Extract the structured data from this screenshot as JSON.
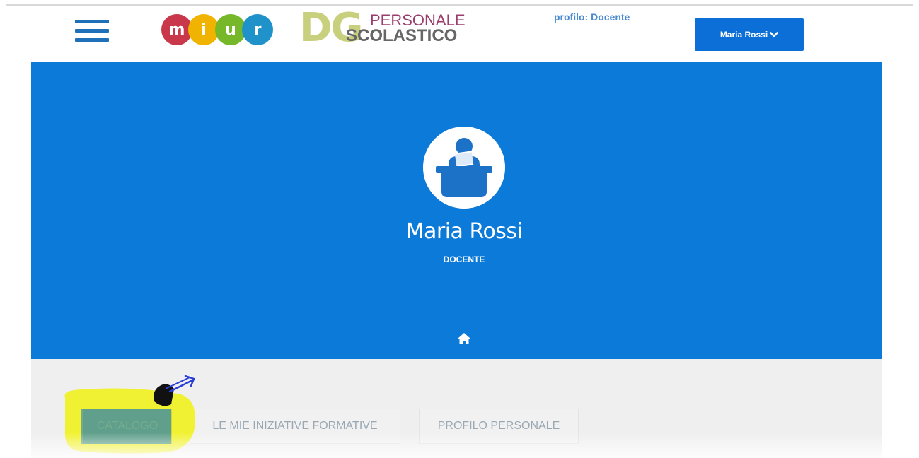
{
  "header": {
    "menu_icon": "hamburger-menu-icon",
    "logo_letters": [
      "m",
      "i",
      "u",
      "r"
    ],
    "logo_colors": [
      "#c9374b",
      "#f0b400",
      "#76b82a",
      "#1f93c9"
    ],
    "dg_logo": {
      "mark": "DG",
      "line1": "PERSONALE",
      "line2": "SCOLASTICO"
    },
    "profile_label": "profilo: Docente",
    "user_button_label": "Maria Rossi",
    "user_button_icon": "chevron-down-icon"
  },
  "banner": {
    "background_color": "#0b7ad8",
    "avatar_icon": "teacher-at-desk-icon",
    "user_name": "Maria Rossi",
    "user_role": "DOCENTE",
    "home_icon": "home-icon"
  },
  "tabs": [
    {
      "label": "CATALOGO",
      "active": true
    },
    {
      "label": "LE MIE INIZIATIVE FORMATIVE",
      "active": false
    },
    {
      "label": "PROFILO PERSONALE",
      "active": false
    }
  ],
  "annotation": {
    "highlight_color": "#f2f20a",
    "pointer_icon": "hand-pointer-annotation-icon"
  }
}
